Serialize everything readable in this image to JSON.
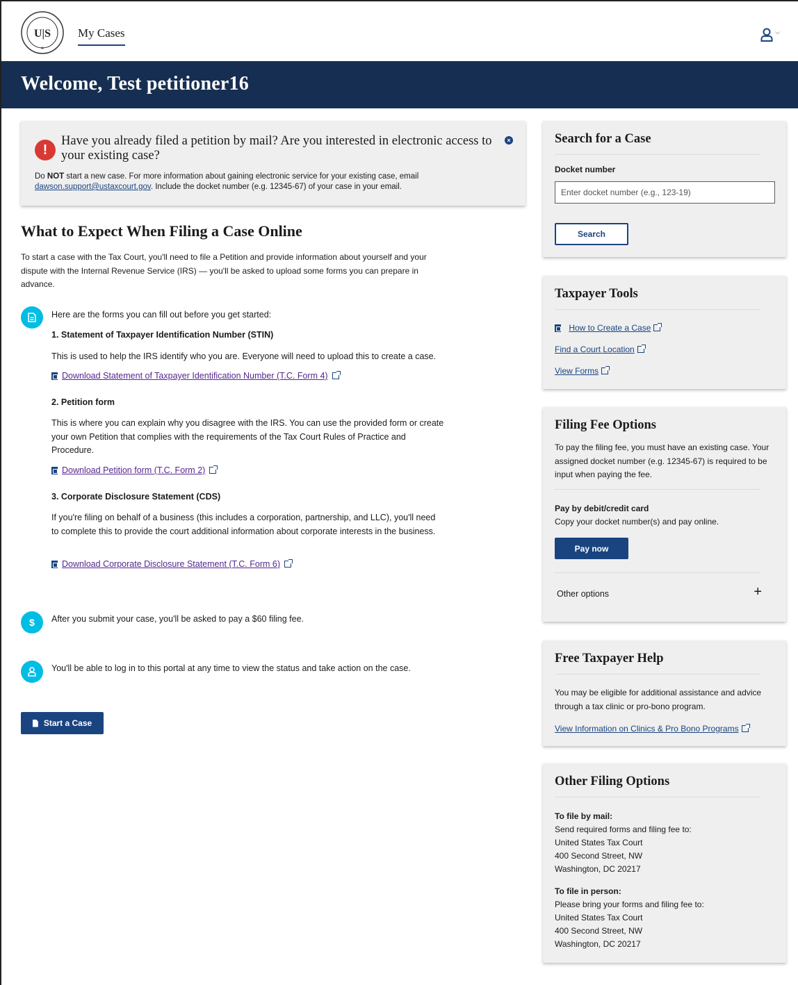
{
  "header": {
    "nav_label": "My Cases",
    "welcome": "Welcome, Test petitioner16"
  },
  "alert": {
    "title": "Have you already filed a petition by mail? Are you interested in electronic access to your existing case?",
    "body_do": "Do ",
    "body_not": "NOT",
    "body_pre": " start a new case. For more information about gaining electronic service for your existing case, email",
    "email": "dawson.support@ustaxcourt.gov",
    "body_post": ". Include the docket number (e.g. 12345-67) of your case in your email."
  },
  "expect": {
    "title": "What to Expect When Filing a Case Online",
    "intro": "To start a case with the Tax Court, you'll need to file a Petition and provide information about yourself and your dispute with the Internal Revenue Service (IRS) — you'll be asked to upload some forms you can prepare in advance.",
    "forms_intro": "Here are the forms you can fill out before you get started:",
    "forms": [
      {
        "heading": "1. Statement of Taxpayer Identification Number (STIN)",
        "desc": "This is used to help the IRS identify who you are. Everyone will need to upload this to create a case.",
        "link": "Download Statement of Taxpayer Identification Number (T.C. Form 4)"
      },
      {
        "heading": "2. Petition form",
        "desc": "This is where you can explain why you disagree with the IRS. You can use the provided form or create your own Petition that complies with the requirements of the Tax Court Rules of Practice and Procedure.",
        "link": "Download Petition form (T.C. Form 2)"
      },
      {
        "heading": "3. Corporate Disclosure Statement (CDS)",
        "desc": "If you're filing on behalf of a business (this includes a corporation, partnership, and LLC), you'll need to complete this to provide the court additional information about corporate interests in the business.",
        "link": "Download Corporate Disclosure Statement (T.C. Form 6)"
      }
    ],
    "fee_note": "After you submit your case, you'll be asked to pay a $60 filing fee.",
    "login_note": "You'll be able to log in to this portal at any time to view the status and take action on the case.",
    "start_button": "Start a Case"
  },
  "search_card": {
    "title": "Search for a Case",
    "label": "Docket number",
    "placeholder": "Enter docket number (e.g., 123-19)",
    "button": "Search"
  },
  "tools_card": {
    "title": "Taxpayer Tools",
    "links": [
      "How to Create a Case",
      "Find a Court Location",
      "View Forms"
    ]
  },
  "fee_card": {
    "title": "Filing Fee Options",
    "desc": "To pay the filing fee, you must have an existing case. Your assigned docket number (e.g. 12345-67) is required to be input when paying the fee.",
    "pay_heading": "Pay by debit/credit card",
    "pay_desc": "Copy your docket number(s) and pay online.",
    "pay_button": "Pay now",
    "other": "Other options"
  },
  "help_card": {
    "title": "Free Taxpayer Help",
    "desc": "You may be eligible for additional assistance and advice through a tax clinic or pro-bono program.",
    "link": "View Information on Clinics & Pro Bono Programs"
  },
  "options_card": {
    "title": "Other Filing Options",
    "mail_heading": "To file by mail:",
    "mail_lines": [
      "Send required forms and filing fee to:",
      "United States Tax Court",
      "400 Second Street, NW",
      "Washington, DC 20217"
    ],
    "person_heading": "To file in person:",
    "person_lines": [
      "Please bring your forms and filing fee to:",
      "United States Tax Court",
      "400 Second Street, NW",
      "Washington, DC 20217"
    ]
  },
  "colors": {
    "banner": "#162e51",
    "primary": "#1a4480",
    "step_icon": "#00bde3",
    "alert_icon": "#d83933",
    "visited_link": "#54278f"
  }
}
